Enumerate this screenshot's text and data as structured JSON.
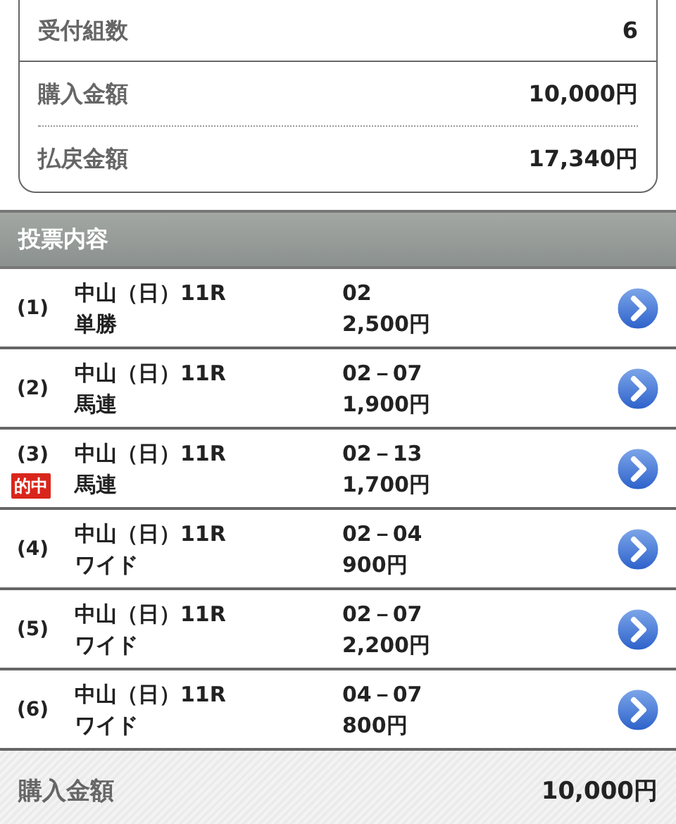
{
  "summary": [
    {
      "label": "受付組数",
      "value": "6"
    },
    {
      "label": "購入金額",
      "value": "10,000円"
    },
    {
      "label": "払戻金額",
      "value": "17,340円"
    }
  ],
  "section_header": "投票内容",
  "bets": [
    {
      "number": "(1)",
      "race": "中山（日）11R",
      "bet_type": "単勝",
      "combination": "02",
      "amount": "2,500円"
    },
    {
      "number": "(2)",
      "race": "中山（日）11R",
      "bet_type": "馬連",
      "combination": "02－07",
      "amount": "1,900円"
    },
    {
      "number": "(3)",
      "badge": "的中",
      "race": "中山（日）11R",
      "bet_type": "馬連",
      "combination": "02－13",
      "amount": "1,700円"
    },
    {
      "number": "(4)",
      "race": "中山（日）11R",
      "bet_type": "ワイド",
      "combination": "02－04",
      "amount": "900円"
    },
    {
      "number": "(5)",
      "race": "中山（日）11R",
      "bet_type": "ワイド",
      "combination": "02－07",
      "amount": "2,200円"
    },
    {
      "number": "(6)",
      "race": "中山（日）11R",
      "bet_type": "ワイド",
      "combination": "04－07",
      "amount": "800円"
    }
  ],
  "footer": {
    "label": "購入金額",
    "value": "10,000円"
  }
}
